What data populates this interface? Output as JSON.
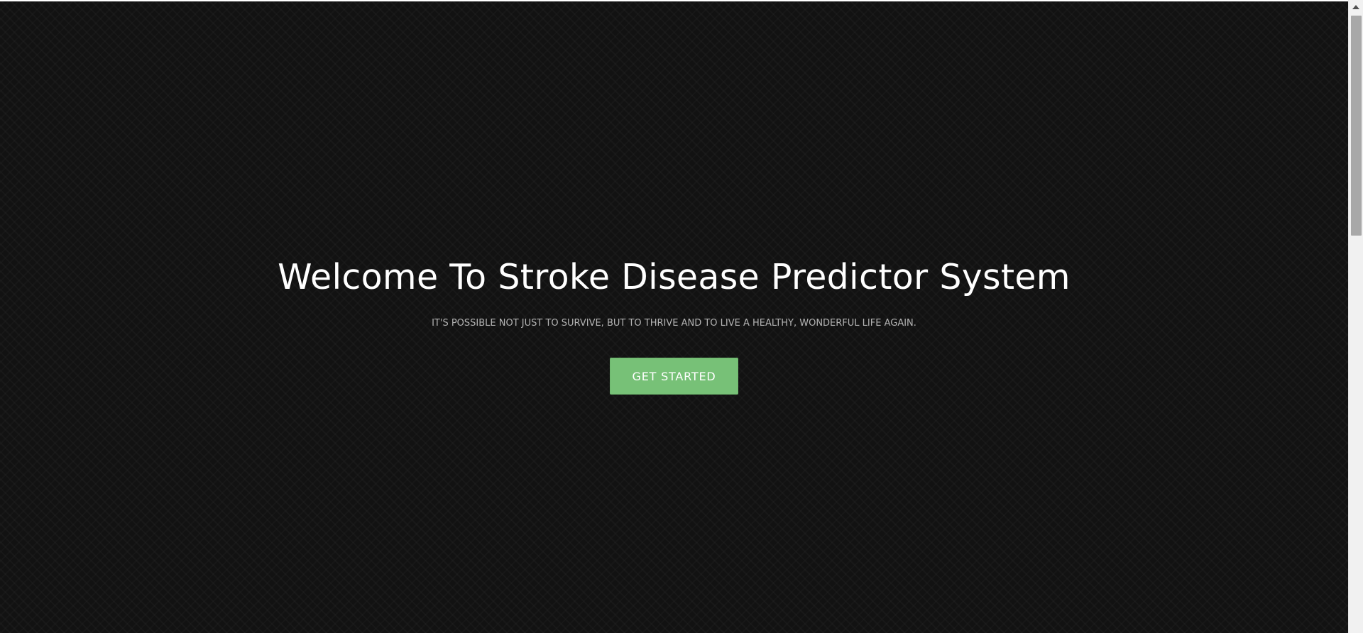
{
  "hero": {
    "title": "Welcome To Stroke Disease Predictor System",
    "subtitle": "IT'S POSSIBLE NOT JUST TO SURVIVE, BUT TO THRIVE AND TO LIVE A HEALTHY, WONDERFUL LIFE AGAIN.",
    "cta_label": "GET STARTED"
  },
  "colors": {
    "background": "#121212",
    "title_text": "#ffffff",
    "subtitle_text": "#b4b4b4",
    "cta_background": "#77c177",
    "cta_text": "#ffffff"
  },
  "scrollbar": {
    "up_icon": "arrow-up-icon"
  }
}
